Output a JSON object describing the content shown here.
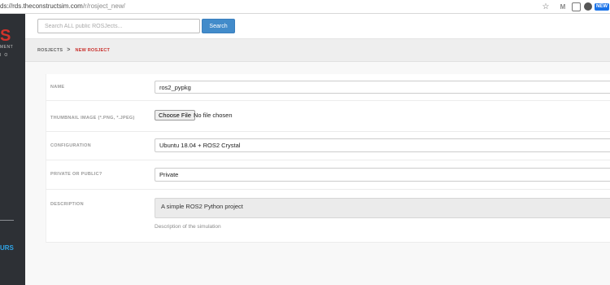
{
  "browser": {
    "url_host": "ds://rds.theconstructsim.com",
    "url_path": "/r/rosject_new/",
    "extensions": [
      "star-icon",
      "gmail-icon",
      "extension-icon",
      "zoom-icon",
      "new-badge-icon"
    ],
    "new_badge": "NEW"
  },
  "sidebar": {
    "logo_fragment": "S",
    "logo_line1": "MENT",
    "logo_line2": "IO",
    "nav_fragment": "URS",
    "brand_color": "#d2332b",
    "link_color": "#2fa4e7"
  },
  "header": {
    "search_placeholder": "Search ALL public ROSJects...",
    "search_button": "Search"
  },
  "breadcrumb": {
    "parent": "ROSJECTS",
    "separator": ">",
    "current": "NEW ROSJECT"
  },
  "form": {
    "name": {
      "label": "NAME",
      "value": "ros2_pypkg"
    },
    "thumbnail": {
      "label": "THUMBNAIL IMAGE (*.PNG, *.JPEG)",
      "button": "Choose File",
      "status": "No file chosen"
    },
    "configuration": {
      "label": "CONFIGURATION",
      "value": "Ubuntu 18.04 + ROS2 Crystal"
    },
    "visibility": {
      "label": "PRIVATE OR PUBLIC?",
      "value": "Private"
    },
    "description": {
      "label": "DESCRIPTION",
      "value": "A simple ROS2 Python project",
      "help": "Description of the simulation"
    }
  },
  "colors": {
    "primary_button": "#428bca",
    "breadcrumb_active": "#c9302c",
    "sidebar_bg": "#2d3035"
  }
}
